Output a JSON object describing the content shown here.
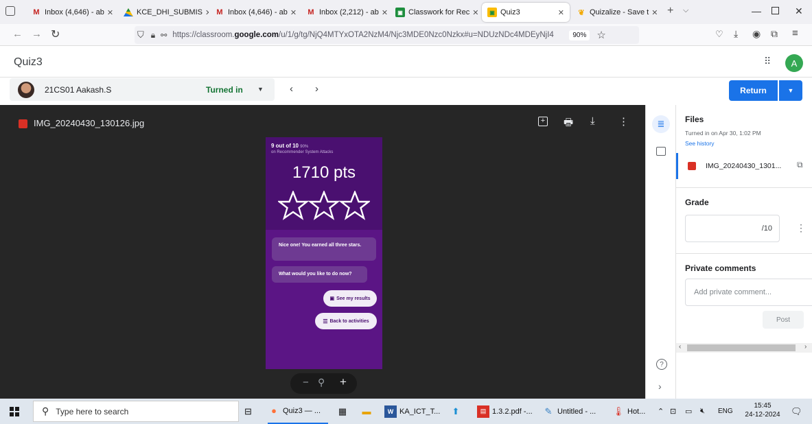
{
  "browser": {
    "tabs": [
      {
        "label": "Inbox (4,646) - ab",
        "icon": "gmail-icon",
        "active": false
      },
      {
        "label": "KCE_DHI_SUBMIS",
        "icon": "drive-icon",
        "active": false
      },
      {
        "label": "Inbox (4,646) - ab",
        "icon": "gmail-icon",
        "active": false
      },
      {
        "label": "Inbox (2,212) - ab",
        "icon": "gmail-icon",
        "active": false
      },
      {
        "label": "Classwork for Rec",
        "icon": "classroom-icon",
        "active": false
      },
      {
        "label": "Quiz3",
        "icon": "classroom-icon",
        "active": true
      },
      {
        "label": "Quizalize - Save t",
        "icon": "quizalize-icon",
        "active": false
      }
    ],
    "url_prefix": "https://classroom.",
    "url_domain": "google.com",
    "url_rest": "/u/1/g/tg/NjQ4MTYxOTA2NzM4/Njc3MDE0Nzc0Nzkx#u=NDUzNDc4MDEyNjI4",
    "zoom": "90%"
  },
  "app": {
    "title": "Quiz3",
    "account_initial": "A"
  },
  "student": {
    "name": "21CS01 Aakash.S",
    "status": "Turned in",
    "return_label": "Return"
  },
  "viewer": {
    "filename": "IMG_20240430_130126.jpg",
    "score_line": "9 out of 10",
    "score_pct": "90%",
    "score_sub": "on Recommender System Attacks",
    "points": "1710 pts",
    "stars": 3,
    "msg1": "Nice one! You earned all three stars.",
    "msg2": "What would you like to do now?",
    "btn_results": "See my results",
    "btn_back": "Back to activities"
  },
  "panel": {
    "files_heading": "Files",
    "turned_in_on": "Turned in on Apr 30, 1:02 PM",
    "see_history": "See history",
    "attachment": "IMG_20240430_1301...",
    "grade_heading": "Grade",
    "grade_denominator": "/10",
    "comments_heading": "Private comments",
    "comment_placeholder": "Add private comment...",
    "post_label": "Post"
  },
  "taskbar": {
    "search_placeholder": "Type here to search",
    "items": [
      "Quiz3 — ...",
      "KA_ICT_T...",
      "1.3.2.pdf -...",
      "Untitled - ...",
      "Hot..."
    ],
    "lang": "ENG",
    "time": "15:45",
    "date": "24-12-2024"
  },
  "colors": {
    "accent_blue": "#1a73e8",
    "quiz_purple": "#4a1070",
    "viewer_bg": "#262626",
    "avatar_green": "#34a853"
  }
}
